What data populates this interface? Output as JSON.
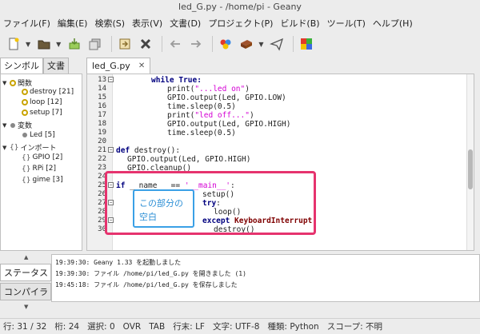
{
  "window": {
    "title": "led_G.py - /home/pi - Geany"
  },
  "menu": [
    "ファイル(F)",
    "編集(E)",
    "検索(S)",
    "表示(V)",
    "文書(D)",
    "プロジェクト(P)",
    "ビルド(B)",
    "ツール(T)",
    "ヘルプ(H)"
  ],
  "sidebar": {
    "tabs": [
      "シンボル",
      "文書"
    ],
    "tree": [
      {
        "label": "関数",
        "kind": "group-fn"
      },
      {
        "label": "destroy [21]",
        "kind": "fn"
      },
      {
        "label": "loop [12]",
        "kind": "fn"
      },
      {
        "label": "setup [7]",
        "kind": "fn"
      },
      {
        "label": "変数",
        "kind": "group-var"
      },
      {
        "label": "Led [5]",
        "kind": "var"
      },
      {
        "label": "インポート",
        "kind": "group-imp"
      },
      {
        "label": "GPIO [2]",
        "kind": "imp"
      },
      {
        "label": "RPi [2]",
        "kind": "imp"
      },
      {
        "label": "gime [3]",
        "kind": "imp"
      }
    ]
  },
  "editor": {
    "tab_label": "led_G.py",
    "line_numbers": [
      "13",
      "14",
      "15",
      "16",
      "17",
      "18",
      "19",
      "20",
      "21",
      "22",
      "23",
      "24",
      "25",
      "26",
      "27",
      "28",
      "29",
      "30"
    ],
    "code": {
      "l13": "while True:",
      "l14a": "print(",
      "l14s": "\"...led on\"",
      "l14b": ")",
      "l15": "GPIO.output(Led, GPIO.LOW)",
      "l16": "time.sleep(0.5)",
      "l17a": "print(",
      "l17s": "\"led off...\"",
      "l17b": ")",
      "l18": "GPIO.output(Led, GPIO.HIGH)",
      "l19": "time.sleep(0.5)",
      "l21k": "def",
      "l21": " destroy():",
      "l22": "GPIO.output(Led, GPIO.HIGH)",
      "l23": "GPIO.cleanup()",
      "l25k": "if",
      "l25a": " __name__ == ",
      "l25s": "'__main__'",
      "l25b": ":",
      "l26": "setup()",
      "l27k": "try",
      "l27": ":",
      "l28": "loop()",
      "l29k": "except",
      "l29e": " KeyboardInterrupt",
      "l29": ":",
      "l30": "destroy()"
    },
    "annotation": [
      "この部分の",
      "空白"
    ]
  },
  "bottom": {
    "tabs": [
      "ステータス",
      "コンパイラ"
    ],
    "messages": [
      "19:39:30: Geany 1.33 を起動しました",
      "19:39:30: ファイル /home/pi/led_G.py を開きました (1)",
      "19:45:18: ファイル /home/pi/led_G.py を保存しました"
    ]
  },
  "status": {
    "line": "行: 31 / 32",
    "col": "桁: 24",
    "sel": "選択: 0",
    "ovr": "OVR",
    "tab": "TAB",
    "eol": "行末: LF",
    "enc": "文字: UTF-8",
    "type": "種類: Python",
    "scope": "スコープ: 不明"
  },
  "colors": {
    "annotation_red": "#e6336e",
    "annotation_blue": "#3aa0e6"
  },
  "toolbar_icons": [
    "new-file-icon",
    "open-file-icon",
    "save-icon",
    "save-all-icon",
    "revert-icon",
    "close-icon",
    "back-icon",
    "forward-icon",
    "compile-icon",
    "build-icon",
    "send-icon",
    "color-picker-icon"
  ]
}
